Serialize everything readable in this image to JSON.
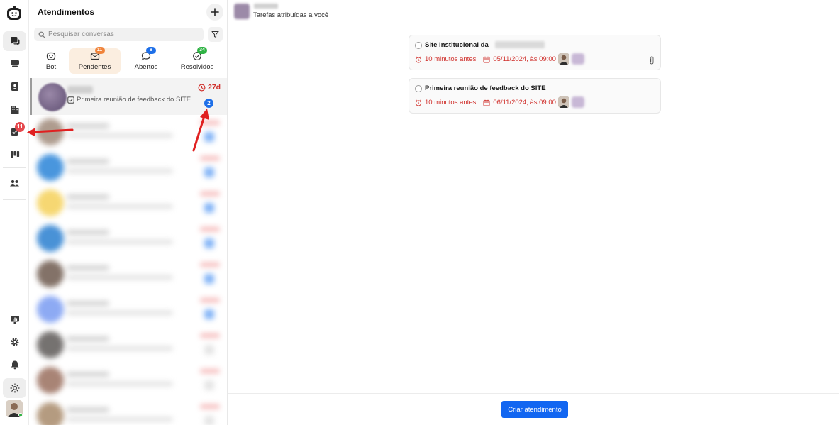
{
  "sidebar": {
    "badge_count": "11",
    "items": [
      {
        "icon": "chat-bubbles-icon",
        "active": true
      },
      {
        "icon": "inbox-tray-icon"
      },
      {
        "icon": "contact-book-icon"
      },
      {
        "icon": "building-icon"
      },
      {
        "icon": "task-check-icon"
      },
      {
        "icon": "kanban-board-icon"
      },
      {
        "icon": "team-icon"
      }
    ],
    "bottom_items": [
      {
        "icon": "monitor-chart-icon"
      },
      {
        "icon": "gear-icon"
      },
      {
        "icon": "bell-icon"
      },
      {
        "icon": "sun-icon"
      }
    ]
  },
  "conversations": {
    "title": "Atendimentos",
    "search_placeholder": "Pesquisar conversas",
    "tabs": [
      {
        "label": "Bot",
        "badge": null
      },
      {
        "label": "Pendentes",
        "badge": "11",
        "badge_color": "#f0833a",
        "active": true
      },
      {
        "label": "Abertos",
        "badge": "8",
        "badge_color": "#1e6fe8"
      },
      {
        "label": "Resolvidos",
        "badge": "34",
        "badge_color": "#2fb344"
      }
    ],
    "active_item": {
      "preview": "Primeira reunião de feedback do SITE",
      "time": "27d",
      "unread": "2"
    }
  },
  "main": {
    "subtitle": "Tarefas atribuídas a você",
    "tasks": [
      {
        "title": "Site institucional da",
        "due_relative": "10 minutos antes",
        "due_date": "05/11/2024, às 09:00"
      },
      {
        "title": "Primeira reunião de feedback do SITE",
        "due_relative": "10 minutos antes",
        "due_date": "06/11/2024, às 09:00"
      }
    ],
    "create_button": "Criar atendimento"
  },
  "colors": {
    "accent": "#1266f1",
    "danger": "#d0312d",
    "active_tab_bg": "#fbeee0"
  }
}
